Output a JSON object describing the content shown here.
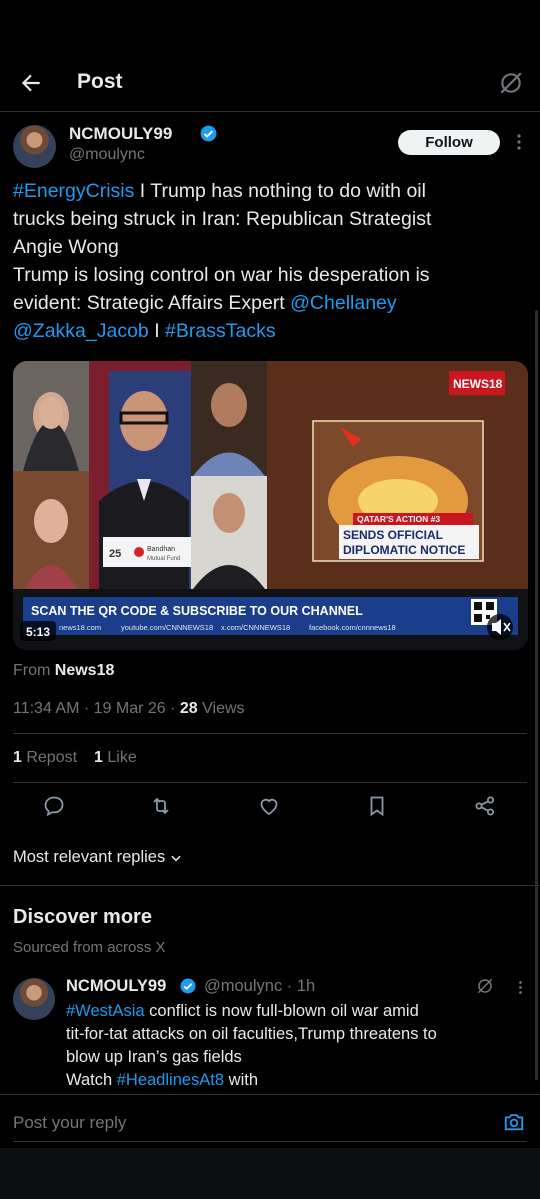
{
  "header": {
    "title": "Post"
  },
  "post": {
    "author_name": "NCMOULY99",
    "author_handle": "@moulync",
    "follow_label": "Follow",
    "text_lines": [
      [
        {
          "t": "#EnergyCrisis",
          "link": true
        },
        {
          "t": " I Trump has nothing to do with oil",
          "link": false
        }
      ],
      [
        {
          "t": "trucks being struck in Iran: Republican Strategist",
          "link": false
        }
      ],
      [
        {
          "t": "Angie Wong",
          "link": false
        }
      ],
      [
        {
          "t": "Trump is losing control on war his desperation is",
          "link": false
        }
      ],
      [
        {
          "t": "evident: Strategic Affairs Expert ",
          "link": false
        },
        {
          "t": "@Chellaney",
          "link": true
        }
      ],
      [
        {
          "t": "@Zakka_Jacob",
          "link": true
        },
        {
          "t": " I ",
          "link": false
        },
        {
          "t": "#BrassTacks",
          "link": true
        }
      ]
    ],
    "video": {
      "duration": "5:13",
      "channel_logo": "NEWS18",
      "qatar_label": "QATAR'S ACTION #3",
      "notice_line1": "SENDS OFFICIAL",
      "notice_line2": "DIPLOMATIC NOTICE",
      "ticker_main": "SCAN THE QR CODE & SUBSCRIBE TO OUR CHANNEL",
      "ticker_links": [
        "news18.com",
        "youtube.com/CNNNEWS18",
        "x.com/CNNNEWS18",
        "facebook.com/cnnnews18"
      ],
      "sponsor_number": "25",
      "sponsor_name": "Bandhan",
      "sponsor_sub": "Mutual Fund"
    },
    "source_prefix": "From ",
    "source_name": "News18",
    "time": "11:34 AM · 19 Mar 26 · ",
    "views_count": "28",
    "views_label": " Views",
    "repost_count": "1",
    "repost_label": " Repost",
    "like_count": "1",
    "like_label": " Like"
  },
  "replies_filter": "Most relevant replies",
  "discover": {
    "title": "Discover more",
    "subtitle": "Sourced from across X",
    "reply": {
      "name": "NCMOULY99",
      "handle_time": "@moulync · 1h",
      "lines": [
        [
          {
            "t": "#WestAsia",
            "link": true
          },
          {
            "t": " conflict is now full-blown oil war amid",
            "link": false
          }
        ],
        [
          {
            "t": "tit-for-tat attacks on oil faculties,Trump threatens to",
            "link": false
          }
        ],
        [
          {
            "t": "blow up Iran’s gas fields",
            "link": false
          }
        ],
        [
          {
            "t": "Watch ",
            "link": false
          },
          {
            "t": "#HeadlinesAt8",
            "link": true
          },
          {
            "t": " with",
            "link": false
          }
        ]
      ]
    }
  },
  "composer": {
    "placeholder": "Post your reply"
  },
  "colors": {
    "accent": "#1d9bf0",
    "background": "#000000",
    "muted": "#71767b",
    "divider": "#2f3336"
  },
  "icons": [
    "back-arrow-icon",
    "grok-icon",
    "verified-badge-icon",
    "more-icon",
    "reply-icon",
    "repost-icon",
    "like-icon",
    "bookmark-icon",
    "share-icon",
    "chevron-down-icon",
    "camera-icon",
    "mute-icon"
  ]
}
